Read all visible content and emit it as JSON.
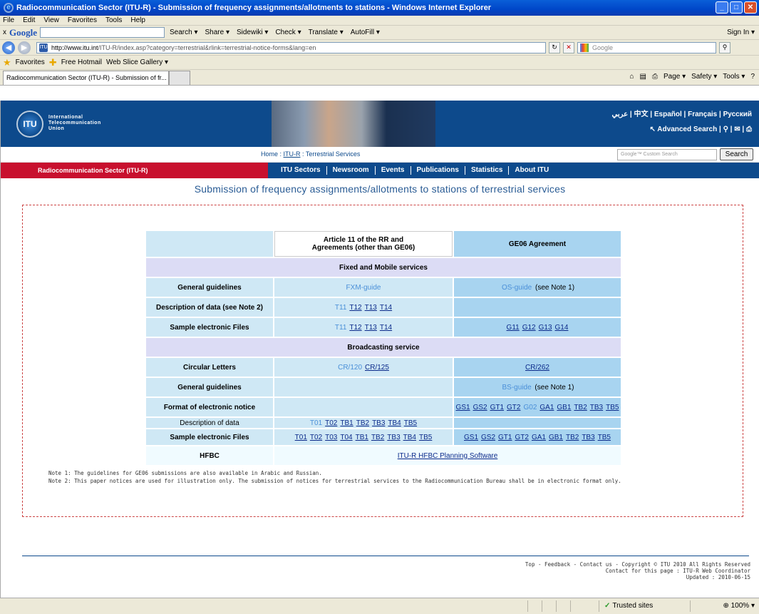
{
  "window": {
    "title": "Radiocommunication Sector (ITU-R) - Submission of frequency assignments/allotments to stations  - Windows Internet Explorer",
    "minimize": "_",
    "maximize": "□",
    "close": "✕"
  },
  "menu": [
    "File",
    "Edit",
    "View",
    "Favorites",
    "Tools",
    "Help"
  ],
  "google_toolbar": {
    "close": "x",
    "logo": "Google",
    "items": [
      "Search ▾",
      "Share ▾",
      "Sidewiki ▾",
      "Check ▾",
      "Translate ▾",
      "AutoFill ▾"
    ],
    "sign_in": "Sign In ▾"
  },
  "address": {
    "url_host": "http://www.itu.int",
    "url_path": "/ITU-R/index.asp?category=terrestrial&rlink=terrestrial-notice-forms&lang=en",
    "search_placeholder": "Google"
  },
  "favorites": {
    "label": "Favorites",
    "items": [
      "Free Hotmail",
      "Web Slice Gallery ▾"
    ]
  },
  "tab": {
    "title": "Radiocommunication Sector (ITU-R) - Submission of fr...",
    "tools": [
      "Page ▾",
      "Safety ▾",
      "Tools ▾"
    ]
  },
  "banner": {
    "logo_text": "ITU",
    "org_line1": "International",
    "org_line2": "Telecommunication",
    "org_line3": "Union",
    "languages": "عربي | 中文 | Español | Français | Русский",
    "advanced_search": "↖ Advanced Search | ⚲ | ✉ | ⎙"
  },
  "breadcrumb": {
    "home": "Home : ",
    "itur": "ITU-R",
    "sep": " : ",
    "current": "Terrestrial Services"
  },
  "site_search": {
    "placeholder": "Google™ Custom Search",
    "button": "Search"
  },
  "nav": {
    "sector": "Radiocommunication Sector (ITU-R)",
    "items": [
      "ITU Sectors",
      "Newsroom",
      "Events",
      "Publications",
      "Statistics",
      "About ITU"
    ]
  },
  "page_title": "Submission of frequency assignments/allotments to stations of terrestrial services",
  "table": {
    "col_mid_header_1": "Article 11 of the RR and",
    "col_mid_header_2": "Agreements (other than GE06)",
    "col_right_header": "GE06 Agreement",
    "section_fixed": "Fixed and Mobile services",
    "section_broadcast": "Broadcasting service",
    "rows": {
      "fm_guidelines": {
        "label": "General guidelines",
        "mid": "FXM-guide",
        "right_link": "OS-guide",
        "right_note": " (see Note 1)"
      },
      "fm_description": {
        "label": "Description of data (see Note 2)",
        "mid": [
          "T11",
          "T12",
          "T13",
          "T14"
        ]
      },
      "fm_samples": {
        "label": "Sample electronic Files",
        "mid": [
          "T11",
          "T12",
          "T13",
          "T14"
        ],
        "right": [
          "G11",
          "G12",
          "G13",
          "G14"
        ]
      },
      "bc_circular": {
        "label": "Circular Letters",
        "mid": [
          "CR/120",
          "CR/125"
        ],
        "right": [
          "CR/262"
        ]
      },
      "bc_guidelines": {
        "label": "General guidelines",
        "right_link": "BS-guide",
        "right_note": " (see Note 1)"
      },
      "bc_format": {
        "label": "Format of electronic notice",
        "right": [
          "GS1",
          "GS2",
          "GT1",
          "GT2",
          "G02",
          "GA1",
          "GB1",
          "TB2",
          "TB3",
          "TB5"
        ]
      },
      "bc_description": {
        "label": "Description of data",
        "mid": [
          "T01",
          "T02",
          "TB1",
          "TB2",
          "TB3",
          "TB4",
          "TB5"
        ]
      },
      "bc_samples": {
        "label": "Sample electronic Files",
        "mid": [
          "T01",
          "T02",
          "T03",
          "T04",
          "TB1",
          "TB2",
          "TB3",
          "TB4",
          "TB5"
        ],
        "right": [
          "GS1",
          "GS2",
          "GT1",
          "GT2",
          "GA1",
          "GB1",
          "TB2",
          "TB3",
          "TB5"
        ]
      },
      "hfbc": {
        "label": "HFBC",
        "link": "ITU-R HFBC Planning Software"
      }
    }
  },
  "notes": {
    "note1": "Note 1: The guidelines for GE06 submissions are also available in Arabic and Russian.",
    "note2": "Note 2: This paper notices are used for illustration only. The submission of notices for terrestrial services to the Radiocommunication Bureau shall be in electronic format only."
  },
  "footer": {
    "line1": "Top - Feedback - Contact us -  Copyright © ITU 2010 All Rights Reserved",
    "line2": "Contact for this page : ITU-R Web Coordinator",
    "line3": "Updated : 2010-06-15"
  },
  "status": {
    "zone": "Trusted sites",
    "zoom": "100%"
  }
}
